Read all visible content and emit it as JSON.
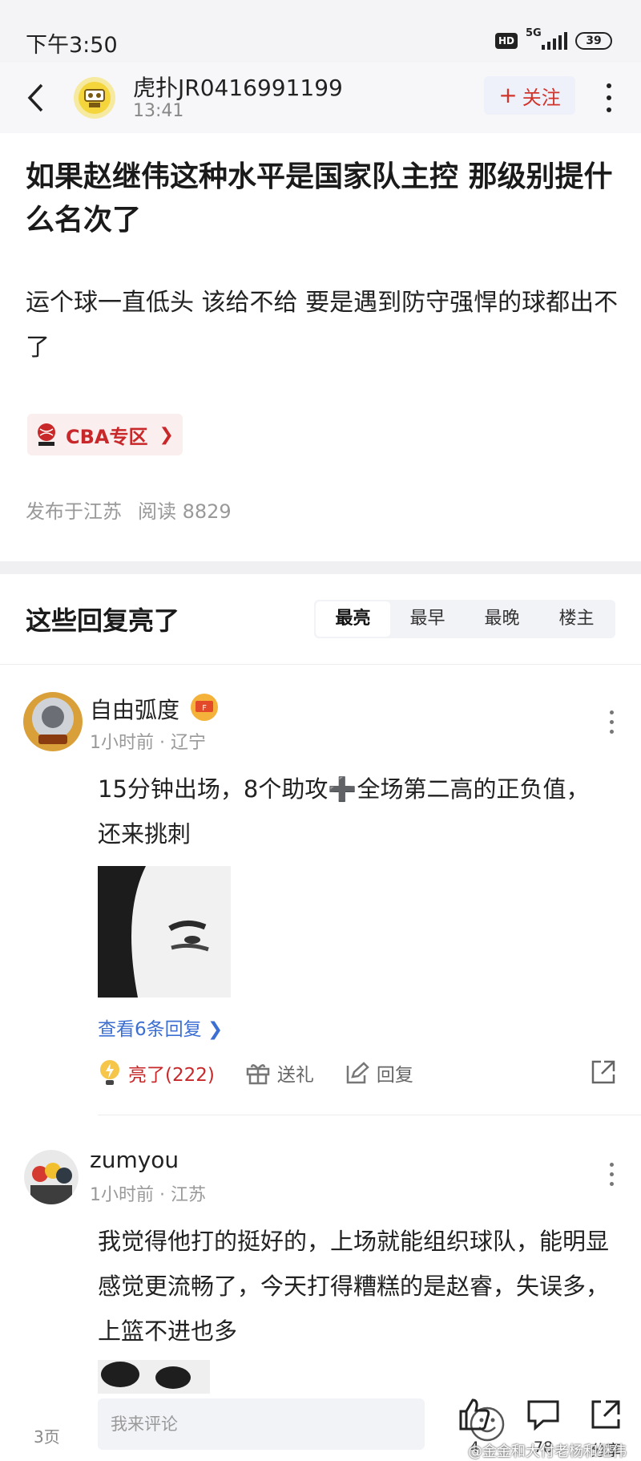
{
  "status_bar": {
    "time": "下午3:50",
    "hd": "HD",
    "network": "5G",
    "battery": "39"
  },
  "header": {
    "author": "虎扑JR0416991199",
    "time": "13:41",
    "follow_label": "关注"
  },
  "post": {
    "title": "如果赵继伟这种水平是国家队主控 那级别提什么名次了",
    "body": "运个球一直低头 该给不给 要是遇到防守强悍的球都出不了",
    "tag": "CBA专区",
    "location": "发布于江苏",
    "reads": "阅读 8829"
  },
  "replies_section": {
    "title": "这些回复亮了",
    "tabs": [
      "最亮",
      "最早",
      "最晚",
      "楼主"
    ],
    "active_tab": 0
  },
  "comments": [
    {
      "user": "自由弧度",
      "meta": "1小时前 · 辽宁",
      "text": "15分钟出场，8个助攻➕全场第二高的正负值，还来挑刺",
      "view_replies": "查看6条回复",
      "like_label": "亮了(222)",
      "gift_label": "送礼",
      "reply_label": "回复"
    },
    {
      "user": "zumyou",
      "meta": "1小时前 · 江苏",
      "text": "我觉得他打的挺好的，上场就能组织球队，能明显感觉更流畅了，今天打得糟糕的是赵睿，失误多，上篮不进也多"
    }
  ],
  "bottom_bar": {
    "page_count": "3页",
    "input_placeholder": "我来评论",
    "likes": "4",
    "comments": "78",
    "share": "分享"
  },
  "watermark": "@金金和大付老杨和继伟",
  "colors": {
    "accent_red": "#c8282a",
    "link_blue": "#3c6fd1",
    "muted": "#999999"
  }
}
